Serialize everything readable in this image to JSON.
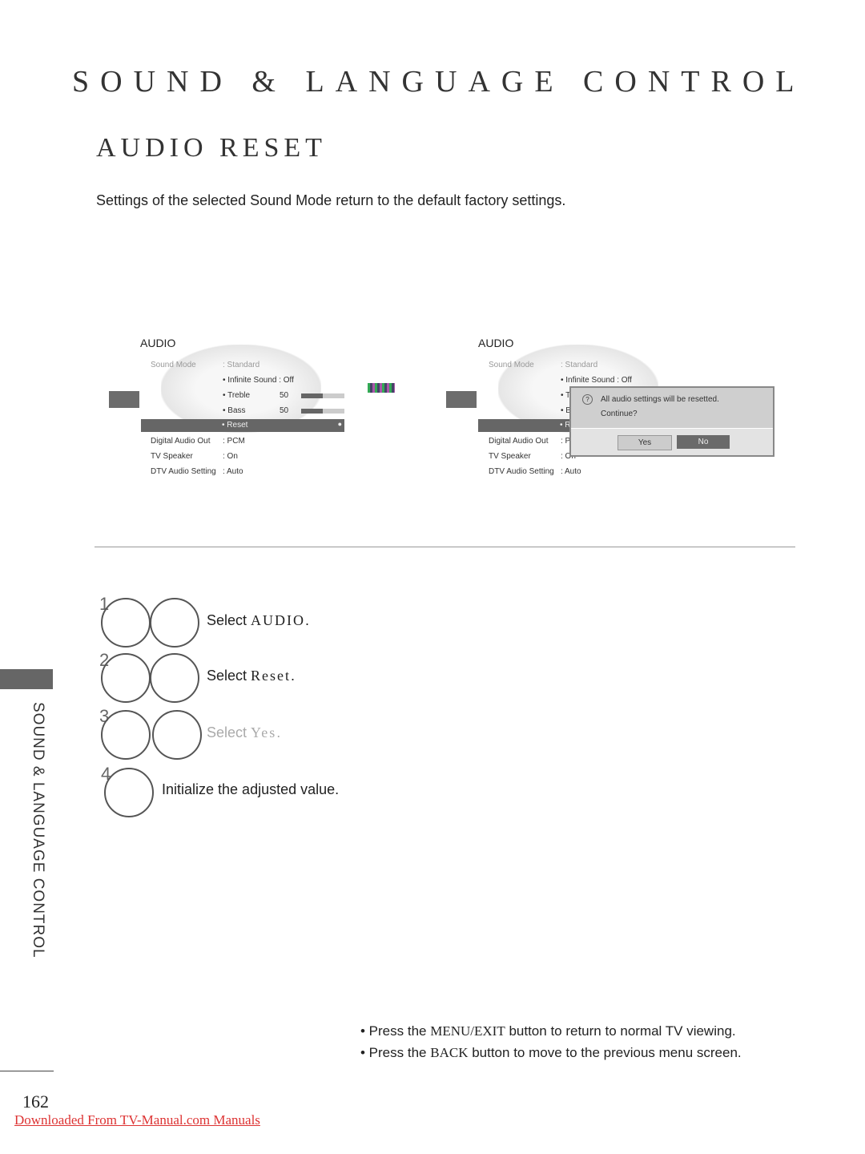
{
  "header": {
    "title": "SOUND & LANGUAGE CONTROL",
    "subtitle": "AUDIO RESET"
  },
  "intro": "Settings of the selected Sound Mode return to the default factory settings.",
  "menu_left": {
    "heading": "AUDIO",
    "rows": [
      {
        "label": "Sound Mode",
        "value": ": Standard"
      },
      {
        "value": "• Infinite Sound : Off"
      },
      {
        "value": "• Treble",
        "num": "50",
        "level": 50
      },
      {
        "value": "• Bass",
        "num": "50",
        "level": 50
      },
      {
        "value": "• Reset"
      },
      {
        "label": "Digital Audio Out",
        "value": ": PCM"
      },
      {
        "label": "TV Speaker",
        "value": ": On"
      },
      {
        "label": "DTV Audio Setting",
        "value": ": Auto"
      }
    ]
  },
  "menu_right": {
    "heading": "AUDIO",
    "rows": [
      {
        "label": "Sound Mode",
        "value": ": Standard"
      },
      {
        "value": "• Infinite Sound : Off"
      },
      {
        "value": "• T"
      },
      {
        "value": "• B"
      },
      {
        "value": "• R"
      },
      {
        "label": "Digital Audio Out",
        "value": ": P"
      },
      {
        "label": "TV Speaker",
        "value": ": On"
      },
      {
        "label": "DTV Audio Setting",
        "value": ": Auto"
      }
    ],
    "dialog": {
      "icon": "question-icon",
      "message": "All audio settings will be resetted.",
      "question": "Continue?",
      "yes": "Yes",
      "no": "No"
    }
  },
  "steps": [
    {
      "num": "1",
      "prefix": "Select",
      "keyword": "AUDIO",
      "suffix": "."
    },
    {
      "num": "2",
      "prefix": "Select",
      "keyword": "Reset",
      "suffix": "."
    },
    {
      "num": "3",
      "prefix": "Select",
      "keyword": "Yes",
      "suffix": "."
    },
    {
      "num": "4",
      "text": "Initialize the adjusted value."
    }
  ],
  "side_label": "SOUND & LANGUAGE CONTROL",
  "notes": [
    {
      "pre": "• Press the",
      "key": "MENU/EXIT",
      "post": "button to return to normal TV viewing."
    },
    {
      "pre": "• Press the",
      "key": "BACK",
      "post": "button to move to the previous menu screen."
    }
  ],
  "page_number": "162",
  "download_link": "Downloaded From TV-Manual.com Manuals"
}
